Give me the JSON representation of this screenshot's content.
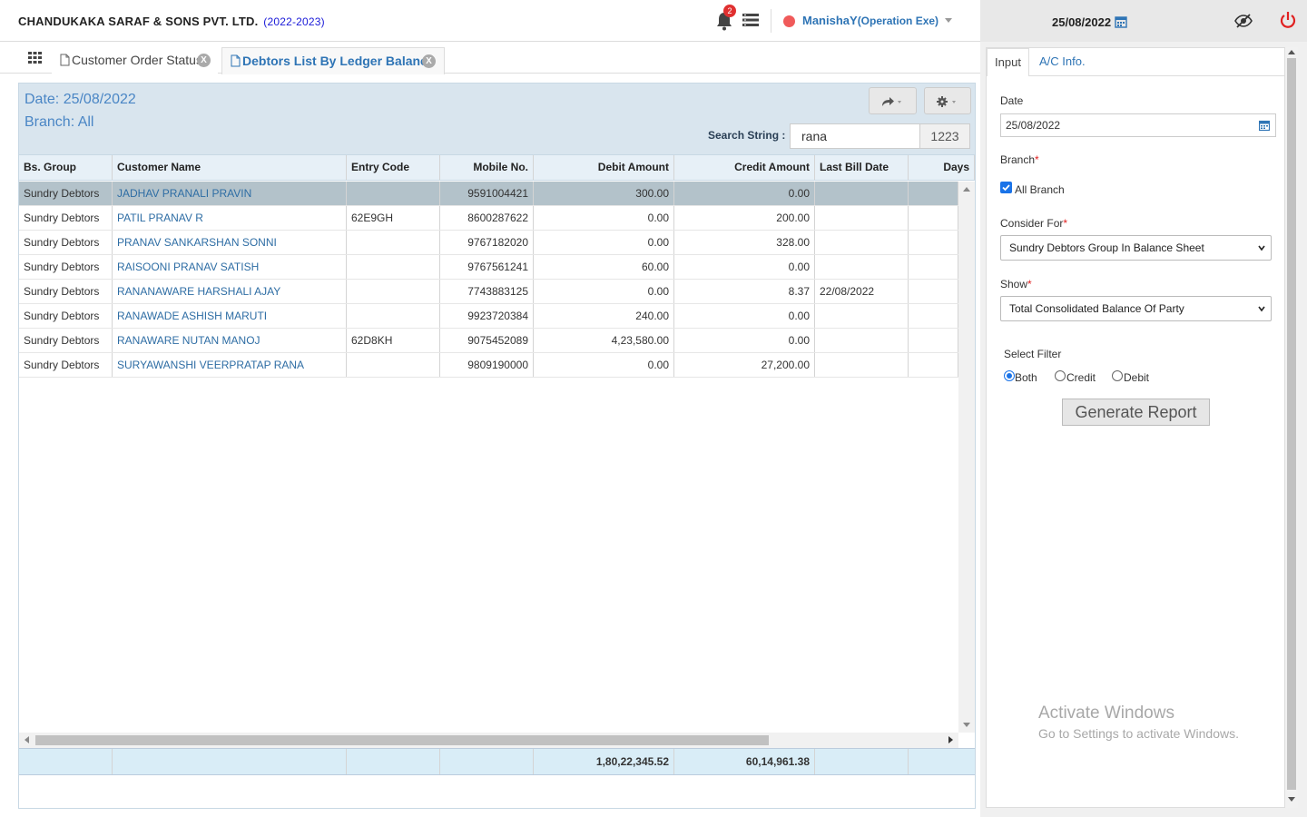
{
  "header": {
    "company": "CHANDUKAKA SARAF & SONS PVT. LTD.",
    "year": "(2022-2023)",
    "notification_count": "2",
    "user_name": "ManishaY",
    "user_role": "(Operation Exe)",
    "date": "25/08/2022"
  },
  "tabs": [
    {
      "label": "Customer Order Status",
      "close": "X"
    },
    {
      "label": "Debtors List By Ledger Balance",
      "close": "X"
    }
  ],
  "report": {
    "date_line": "Date: 25/08/2022",
    "branch_line": "Branch: All",
    "search_label": "Search String :",
    "search_value": "rana",
    "search_count": "1223",
    "columns": [
      "Bs. Group",
      "Customer Name",
      "Entry Code",
      "Mobile No.",
      "Debit Amount",
      "Credit Amount",
      "Last Bill Date",
      "Days"
    ],
    "rows": [
      {
        "group": "Sundry Debtors",
        "name": "JADHAV PRANALI PRAVIN",
        "code": "",
        "mobile": "9591004421",
        "debit": "300.00",
        "credit": "0.00",
        "last_bill": "",
        "days": ""
      },
      {
        "group": "Sundry Debtors",
        "name": "PATIL PRANAV R",
        "code": "62E9GH",
        "mobile": "8600287622",
        "debit": "0.00",
        "credit": "200.00",
        "last_bill": "",
        "days": ""
      },
      {
        "group": "Sundry Debtors",
        "name": "PRANAV SANKARSHAN SONNI",
        "code": "",
        "mobile": "9767182020",
        "debit": "0.00",
        "credit": "328.00",
        "last_bill": "",
        "days": ""
      },
      {
        "group": "Sundry Debtors",
        "name": "RAISOONI PRANAV SATISH",
        "code": "",
        "mobile": "9767561241",
        "debit": "60.00",
        "credit": "0.00",
        "last_bill": "",
        "days": ""
      },
      {
        "group": "Sundry Debtors",
        "name": "RANANAWARE HARSHALI AJAY",
        "code": "",
        "mobile": "7743883125",
        "debit": "0.00",
        "credit": "8.37",
        "last_bill": "22/08/2022",
        "days": ""
      },
      {
        "group": "Sundry Debtors",
        "name": "RANAWADE ASHISH MARUTI",
        "code": "",
        "mobile": "9923720384",
        "debit": "240.00",
        "credit": "0.00",
        "last_bill": "",
        "days": ""
      },
      {
        "group": "Sundry Debtors",
        "name": "RANAWARE NUTAN MANOJ",
        "code": "62D8KH",
        "mobile": "9075452089",
        "debit": "4,23,580.00",
        "credit": "0.00",
        "last_bill": "",
        "days": ""
      },
      {
        "group": "Sundry Debtors",
        "name": "SURYAWANSHI VEERPRATAP RANA",
        "code": "",
        "mobile": "9809190000",
        "debit": "0.00",
        "credit": "27,200.00",
        "last_bill": "",
        "days": ""
      }
    ],
    "total_debit": "1,80,22,345.52",
    "total_credit": "60,14,961.38"
  },
  "panel": {
    "tab_input": "Input",
    "tab_ac": "A/C Info.",
    "date_label": "Date",
    "date_value": "25/08/2022",
    "branch_label": "Branch",
    "all_branch": "All Branch",
    "consider_label": "Consider For",
    "consider_value": "Sundry Debtors Group In Balance Sheet",
    "show_label": "Show",
    "show_value": "Total Consolidated Balance Of Party",
    "filter_label": "Select Filter",
    "filter_both": "Both",
    "filter_credit": "Credit",
    "filter_debit": "Debit",
    "generate": "Generate Report",
    "watermark1": "Activate Windows",
    "watermark2": "Go to Settings to activate Windows."
  },
  "colors": {
    "accent": "#2e74b5",
    "selected_row": "#b3c2ca",
    "header_bg": "#d9e5ee"
  }
}
